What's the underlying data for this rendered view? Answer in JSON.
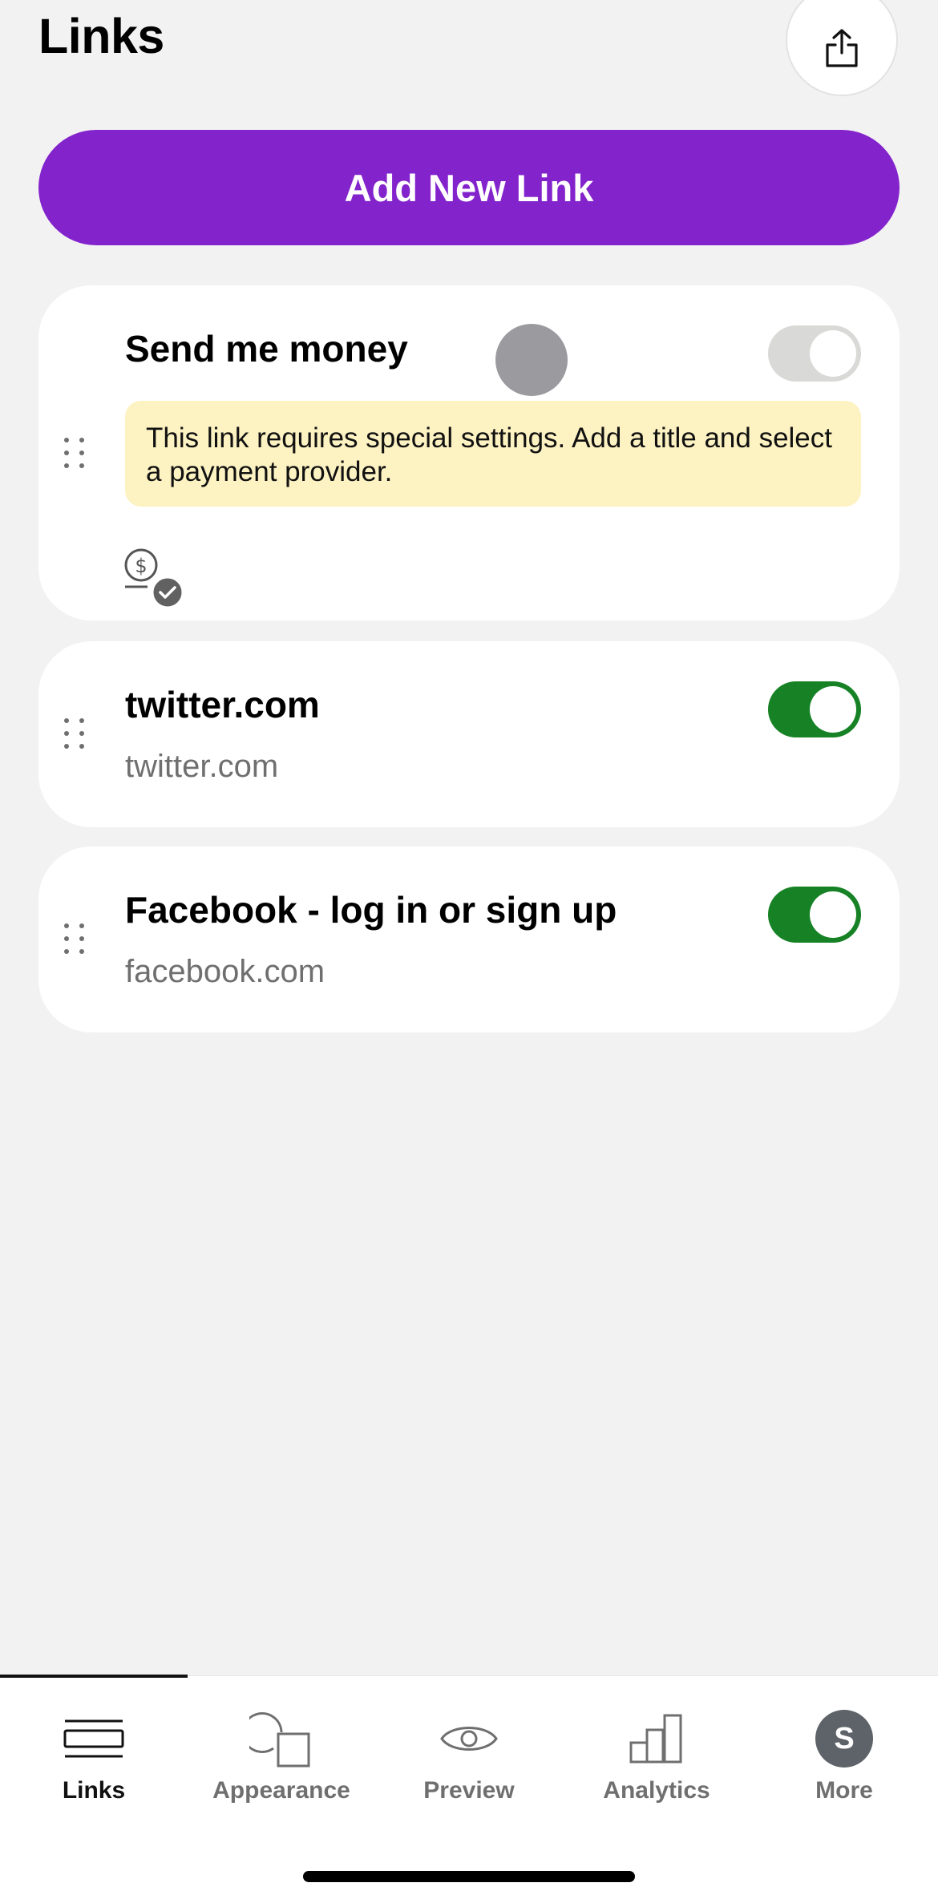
{
  "header": {
    "title": "Links",
    "share_icon": "share-icon"
  },
  "add_button_label": "Add New Link",
  "links": [
    {
      "title": "Send me money",
      "warning": "This link requires special settings. Add a title and select a payment provider.",
      "toggle": "off",
      "icon": "payment-check-icon"
    },
    {
      "title": "twitter.com",
      "url": "twitter.com",
      "toggle": "on"
    },
    {
      "title": "Facebook - log in or sign up",
      "url": "facebook.com",
      "toggle": "on"
    }
  ],
  "tabbar": {
    "tabs": [
      {
        "label": "Links",
        "icon": "links-icon",
        "active": true
      },
      {
        "label": "Appearance",
        "icon": "appearance-icon",
        "active": false
      },
      {
        "label": "Preview",
        "icon": "eye-icon",
        "active": false
      },
      {
        "label": "Analytics",
        "icon": "bar-chart-icon",
        "active": false
      },
      {
        "label": "More",
        "icon": "avatar",
        "avatar_letter": "S",
        "active": false
      }
    ]
  },
  "colors": {
    "accent": "#8323cc",
    "toggle_on": "#168225",
    "toggle_off": "#d9d9d7",
    "warning_bg": "#fdf2c2",
    "background": "#f3f2f3"
  }
}
